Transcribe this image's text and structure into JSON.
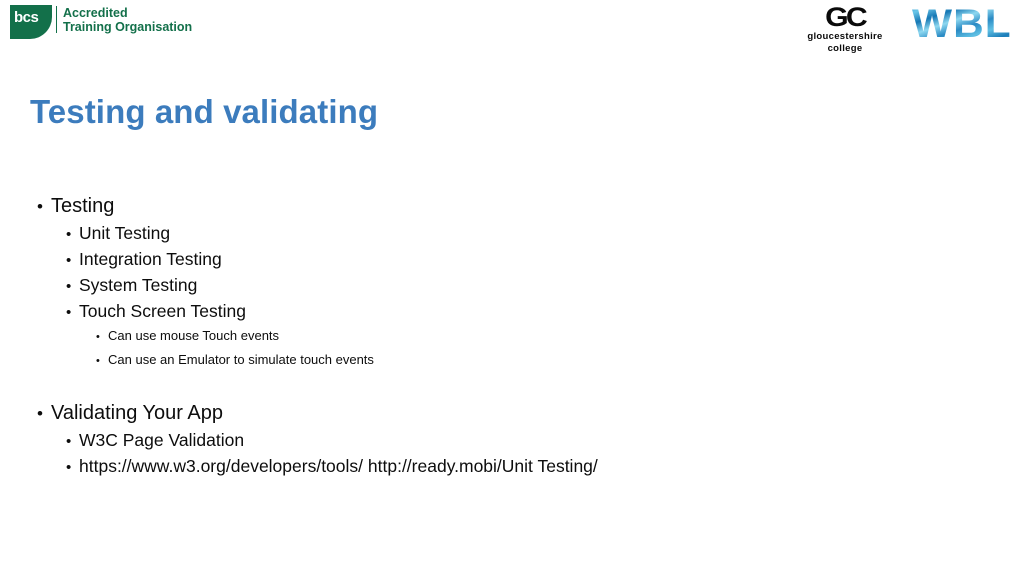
{
  "slide": {
    "title": "Testing and validating",
    "title_color": "#3c7cbd"
  },
  "header": {
    "bcs_logo": {
      "mark_text": "bcs",
      "line1": "Accredited",
      "line2": "Training Organisation",
      "color": "#13704a"
    },
    "gc_logo": {
      "mark_text": "GC",
      "words": "gloucestershire college",
      "color": "#0a0a0a"
    },
    "wbl_logo": {
      "text": "WBL",
      "color": "#2f8fc9"
    }
  },
  "content": {
    "sections": [
      {
        "heading": "Testing",
        "items": [
          {
            "level": 2,
            "text": "Unit Testing"
          },
          {
            "level": 2,
            "text": "Integration Testing"
          },
          {
            "level": 2,
            "text": "System Testing"
          },
          {
            "level": 2,
            "text": "Touch Screen Testing"
          },
          {
            "level": 3,
            "text": "Can use mouse Touch events"
          },
          {
            "level": 3,
            "text": "Can use an Emulator to simulate touch events"
          }
        ]
      },
      {
        "heading": "Validating Your App",
        "items": [
          {
            "level": 2,
            "text": "W3C Page Validation"
          },
          {
            "level": 2,
            "text": "https://www.w3.org/developers/tools/ http://ready.mobi/Unit Testing/"
          }
        ]
      }
    ],
    "bullet_glyph": "•"
  }
}
